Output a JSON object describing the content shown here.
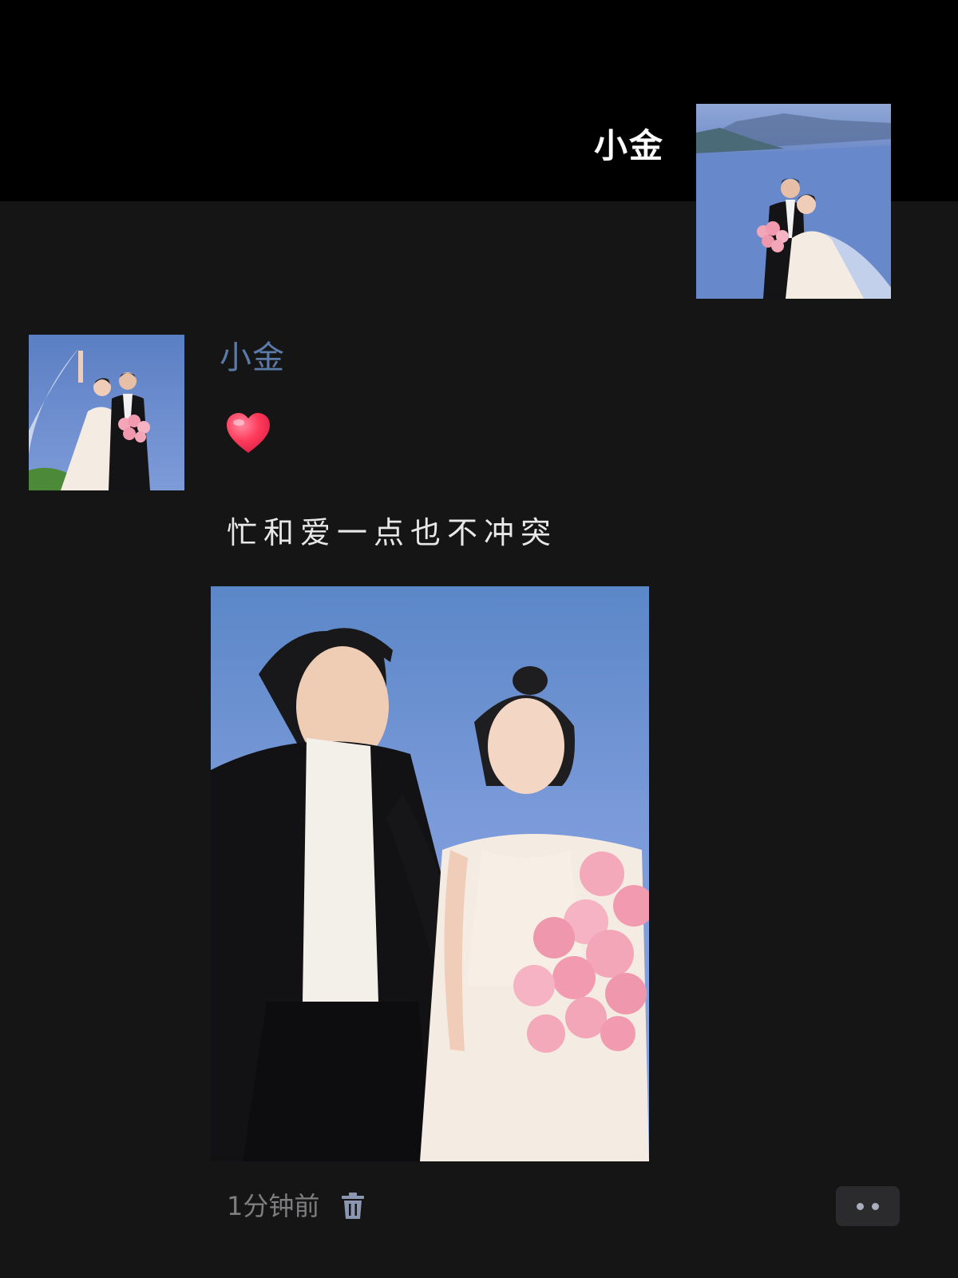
{
  "profile": {
    "name": "小金",
    "avatar_icon": "wedding-couple-photo"
  },
  "post": {
    "author": "小金",
    "avatar_icon": "wedding-couple-photo",
    "emoji_icon": "red-heart-icon",
    "text": "忙和爱一点也不冲突",
    "image_icon": "wedding-couple-holding-hands-photo",
    "time": "1分钟前",
    "delete_icon": "trash-icon",
    "more_icon": "more-dots-icon"
  },
  "colors": {
    "background": "#151516",
    "cover": "#000000",
    "author_link": "#5b7aa8",
    "muted_text": "#7e7e80",
    "heart": "#ff3b5c"
  }
}
